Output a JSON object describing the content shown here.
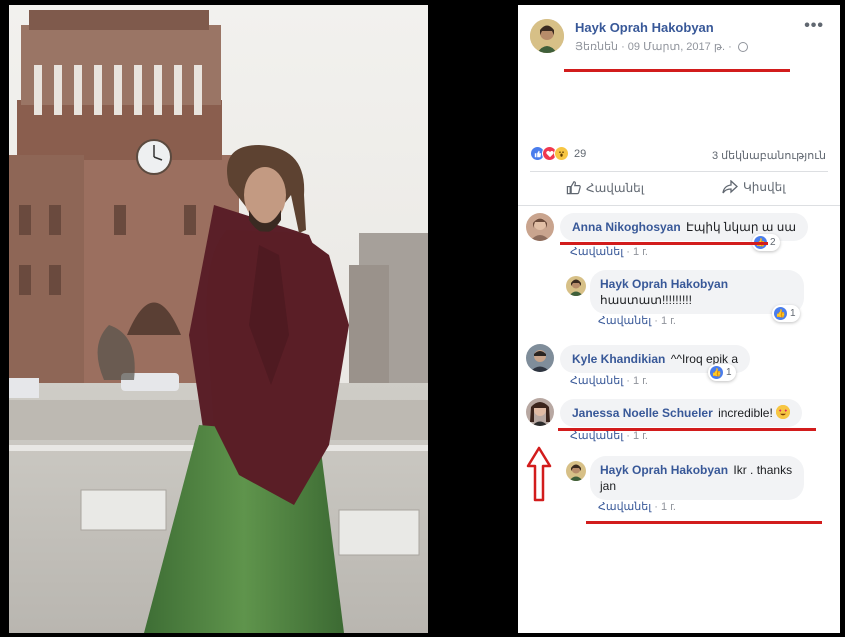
{
  "post": {
    "author": "Hayk Oprah Hakobyan",
    "meta": "Յեռնեն · 09 Մարտ, 2017 թ. ·",
    "reaction_count": "29",
    "comments_count": "3 մեկնաբանություն",
    "like_action": "Հավանել",
    "share_action": "Կիսվել",
    "more": "•••"
  },
  "comments": [
    {
      "author": "Anna Nikoghosyan",
      "text": "Էպիկ նկար ա սա",
      "likes": "2",
      "like_link": "Հավանել",
      "time": "1 г."
    },
    {
      "author": "Hayk Oprah Hakobyan",
      "text": "հաստատ!!!!!!!!!",
      "likes": "1",
      "like_link": "Հավանել",
      "time": "1 г."
    },
    {
      "author": "Kyle Khandikian",
      "text": "^^Iroq epik a",
      "likes": "1",
      "like_link": "Հավանել",
      "time": "1 г."
    },
    {
      "author": "Janessa Noelle Schueler",
      "text": "incredible!",
      "like_link": "Հավանել",
      "time": "1 г."
    },
    {
      "author": "Hayk Oprah Hakobyan",
      "text": "Ikr . thanks jan",
      "like_link": "Հավանել",
      "time": "1 г."
    }
  ],
  "colors": {
    "link": "#385898",
    "annotation_red": "#d21c1c",
    "like_blue": "#4a7dec"
  },
  "icons": [
    "more-options-icon",
    "globe-icon",
    "like-reaction-icon",
    "love-reaction-icon",
    "wow-reaction-icon",
    "thumbs-up-icon",
    "share-arrow-icon",
    "heart-eyes-emoji-icon",
    "red-up-arrow-icon"
  ]
}
